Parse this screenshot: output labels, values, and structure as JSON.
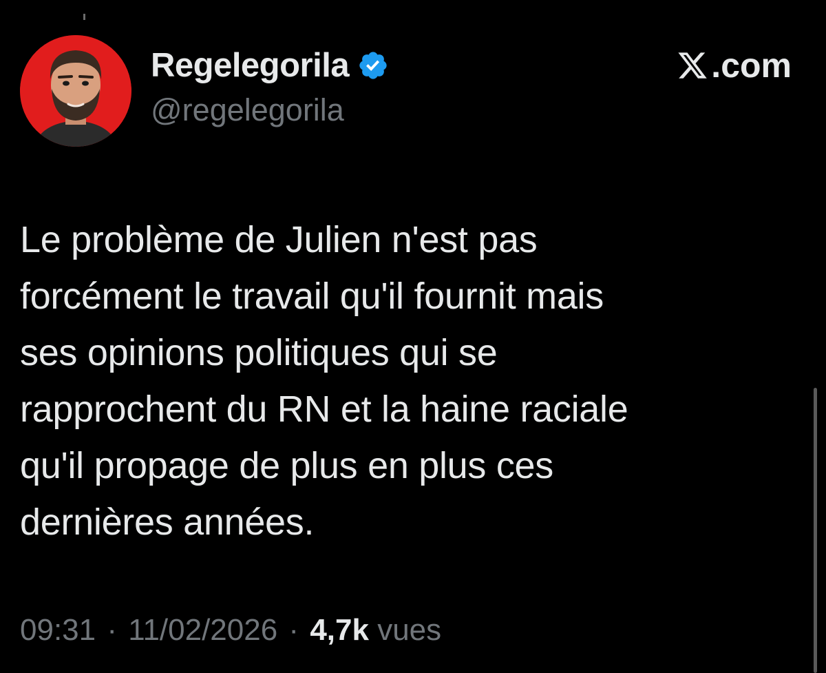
{
  "author": {
    "display_name": "Regelegorila",
    "handle": "@regelegorila",
    "verified_icon": "verified-badge-icon",
    "avatar_background": "#e11d1d"
  },
  "brand": {
    "label": ".com",
    "icon": "x-logo-icon"
  },
  "tweet": {
    "text": "Le problème de Julien n'est pas\nforcément le travail qu'il fournit mais\nses opinions politiques qui se\nrapprochent du RN et la haine raciale\nqu'il propage de plus en plus ces\ndernières années."
  },
  "meta": {
    "time": "09:31",
    "separator": "·",
    "date": "11/02/2026",
    "views_count": "4,7k",
    "views_label": "vues"
  },
  "colors": {
    "background": "#000000",
    "text": "#e7e9ea",
    "muted": "#71767b",
    "verified": "#1d9bf0"
  }
}
